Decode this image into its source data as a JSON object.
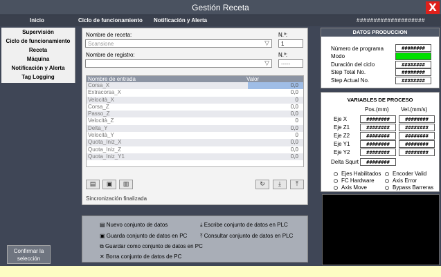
{
  "window": {
    "title": "Gestión Receta",
    "close_label": "X"
  },
  "menu": {
    "items": [
      "Inicio",
      "Ciclo de funcionamiento",
      "Notificación y Alerta"
    ],
    "right_text": "####################"
  },
  "sidebar": {
    "items": [
      "Supervisión",
      "Ciclo de funcionamiento",
      "Receta",
      "Máquina",
      "Notificación y Alerta",
      "Tag Logging"
    ]
  },
  "confirm_button": {
    "line1": "Confirmar la",
    "line2": "selección"
  },
  "recipe": {
    "recipe_name_label": "Nombre de receta:",
    "recipe_name_value": "Scansione",
    "recipe_no_label": "N.º:",
    "recipe_no_value": "1",
    "record_name_label": "Nombre de registro:",
    "record_name_value": "",
    "record_no_label": "N.º:",
    "record_no_value": "-----"
  },
  "table": {
    "col_name": "Nombre de entrada",
    "col_value": "Valor",
    "rows": [
      {
        "name": "Corsa_X",
        "value": "0,0"
      },
      {
        "name": "Extracorsa_X",
        "value": "0,0"
      },
      {
        "name": "Velocità_X",
        "value": "0"
      },
      {
        "name": "Corsa_Z",
        "value": "0,0"
      },
      {
        "name": "Passo_Z",
        "value": "0,0"
      },
      {
        "name": "Velocità_Z",
        "value": "0"
      },
      {
        "name": "Delta_Y",
        "value": "0,0"
      },
      {
        "name": "Velocità_Y",
        "value": "0"
      },
      {
        "name": "Quota_Iniz_X",
        "value": "0,0"
      },
      {
        "name": "Quota_Iniz_Z",
        "value": "0,0"
      },
      {
        "name": "Quota_Iniz_Y1",
        "value": "0,0"
      }
    ]
  },
  "status_text": "Sincronización  finalizada",
  "legend": {
    "new": "Nuevo conjunto de datos",
    "save": "Guarda conjunto de datos en PC",
    "save_as": "Guardar como conjunto de datos en PC",
    "delete": "Borra conjunto de datos de PC",
    "write_plc": "Escribe conjunto de datos en PLC",
    "read_plc": "Consultar conjunto de datos en PLC"
  },
  "production": {
    "title": "DATOS PRODUCCION",
    "rows": [
      "Número de programa",
      "Modo",
      "Duración del ciclo",
      "Step Total No.",
      "Step Actual No."
    ],
    "hash_value": "########",
    "mode_color": "#00e000"
  },
  "process": {
    "title": "VARIABLES DE PROCESO",
    "col_pos": "Pos.(mm)",
    "col_vel": "Vel.(mm/s)",
    "axes": [
      "Eje X",
      "Eje Z1",
      "Eje Z2",
      "Eje Y1",
      "Eje Y2"
    ],
    "delta_label": "Delta Squrt",
    "hash_value": "########",
    "radios": [
      "Ejes Habilitados",
      "Encoder Valid",
      "FC Hardware",
      "Axis Error",
      "Axis Move",
      "Bypass Barreras"
    ]
  }
}
